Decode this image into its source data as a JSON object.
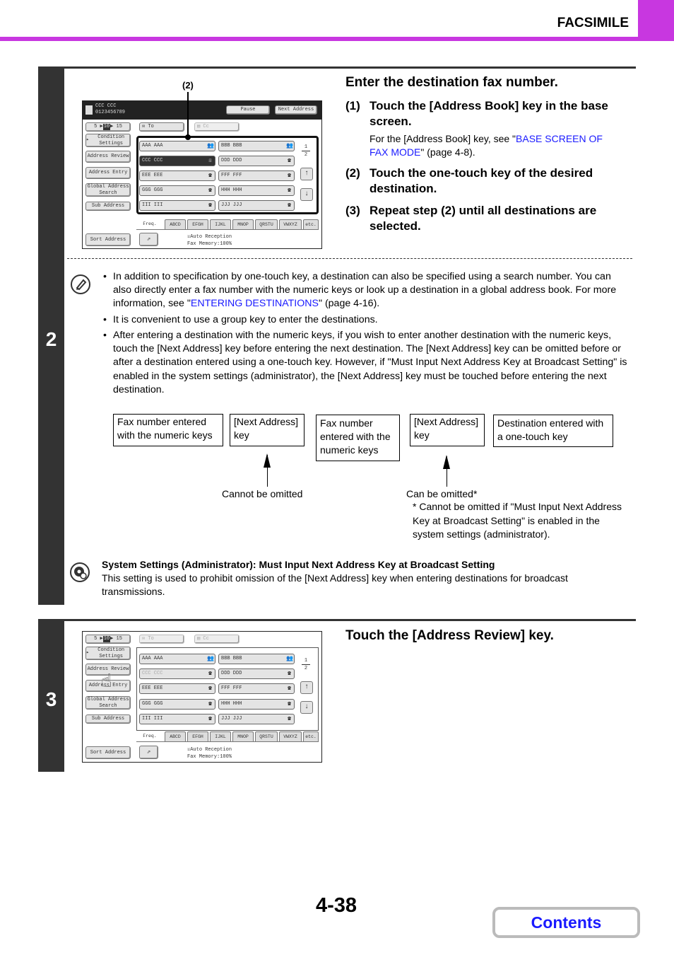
{
  "header": {
    "section": "FACSIMILE",
    "accent_color": "#c837e0"
  },
  "steps": [
    {
      "number": "2",
      "title": "Enter the destination fax number.",
      "substeps": [
        {
          "num": "(1)",
          "text": "Touch the [Address Book] key in the base screen.",
          "note_pre": "For the [Address Book] key, see \"",
          "note_link": "BASE SCREEN OF FAX MODE",
          "note_post": "\" (page 4-8)."
        },
        {
          "num": "(2)",
          "text": "Touch the one-touch key of the desired destination."
        },
        {
          "num": "(3)",
          "text": "Repeat step (2) until all destinations are selected."
        }
      ],
      "callout": "(2)",
      "notes": [
        {
          "pre": "In addition to specification by one-touch key, a destination can also be specified using a search number. You can also directly enter a fax number with the numeric keys or look up a destination in a global address book. For more information, see \"",
          "link": "ENTERING DESTINATIONS",
          "post": "\" (page 4-16)."
        },
        {
          "text": "It is convenient to use a group key to enter the destinations."
        },
        {
          "text": "After entering a destination with the numeric keys, if you wish to enter another destination with the numeric keys, touch the [Next Address] key before entering the next destination. The [Next Address] key can be omitted before or after a destination entered using a one-touch key. However, if \"Must Input Next Address Key at Broadcast Setting\" is enabled in the system settings (administrator), the [Next Address] key must be touched before entering the next destination."
        }
      ],
      "diagram": {
        "boxes": [
          "Fax number entered with the numeric keys",
          "[Next Address] key",
          "Fax number entered with the numeric keys",
          "[Next Address] key",
          "Destination entered with a one-touch key"
        ],
        "label_left": "Cannot be omitted",
        "label_right": "Can be omitted*",
        "footnote": "* Cannot be omitted if \"Must Input Next Address Key at Broadcast Setting\" is enabled in the system settings (administrator)."
      },
      "system_setting": {
        "title": "System Settings (Administrator): Must Input Next Address Key at Broadcast Setting",
        "text": "This setting is used to prohibit omission of the [Next Address] key when entering destinations for broadcast transmissions."
      }
    },
    {
      "number": "3",
      "title": "Touch the [Address Review] key."
    }
  ],
  "fax_screen": {
    "dest_name": "CCC CCC",
    "dest_number": "0123456789",
    "pause": "Pause",
    "next_address": "Next Address",
    "counter": [
      "5",
      "10",
      "15"
    ],
    "to": "To",
    "cc": "Cc",
    "left_buttons": [
      "Condition Settings",
      "Address Review",
      "Address Entry",
      "Global Address Search",
      "Sub Address",
      "Sort Address"
    ],
    "keys": [
      "AAA AAA",
      "BBB BBB",
      "CCC CCC",
      "DDD DDD",
      "EEE EEE",
      "FFF FFF",
      "GGG GGG",
      "HHH HHH",
      "III III",
      "JJJ JJJ"
    ],
    "page": {
      "current": "1",
      "total": "2"
    },
    "tabs": [
      "Freq.",
      "ABCD",
      "EFGH",
      "IJKL",
      "MNOP",
      "QRSTU",
      "VWXYZ",
      "etc."
    ],
    "status_line1": "Auto Reception",
    "status_line2": "Fax Memory:100%"
  },
  "footer": {
    "page_number": "4-38",
    "contents": "Contents",
    "link_color": "#1a1aff"
  }
}
